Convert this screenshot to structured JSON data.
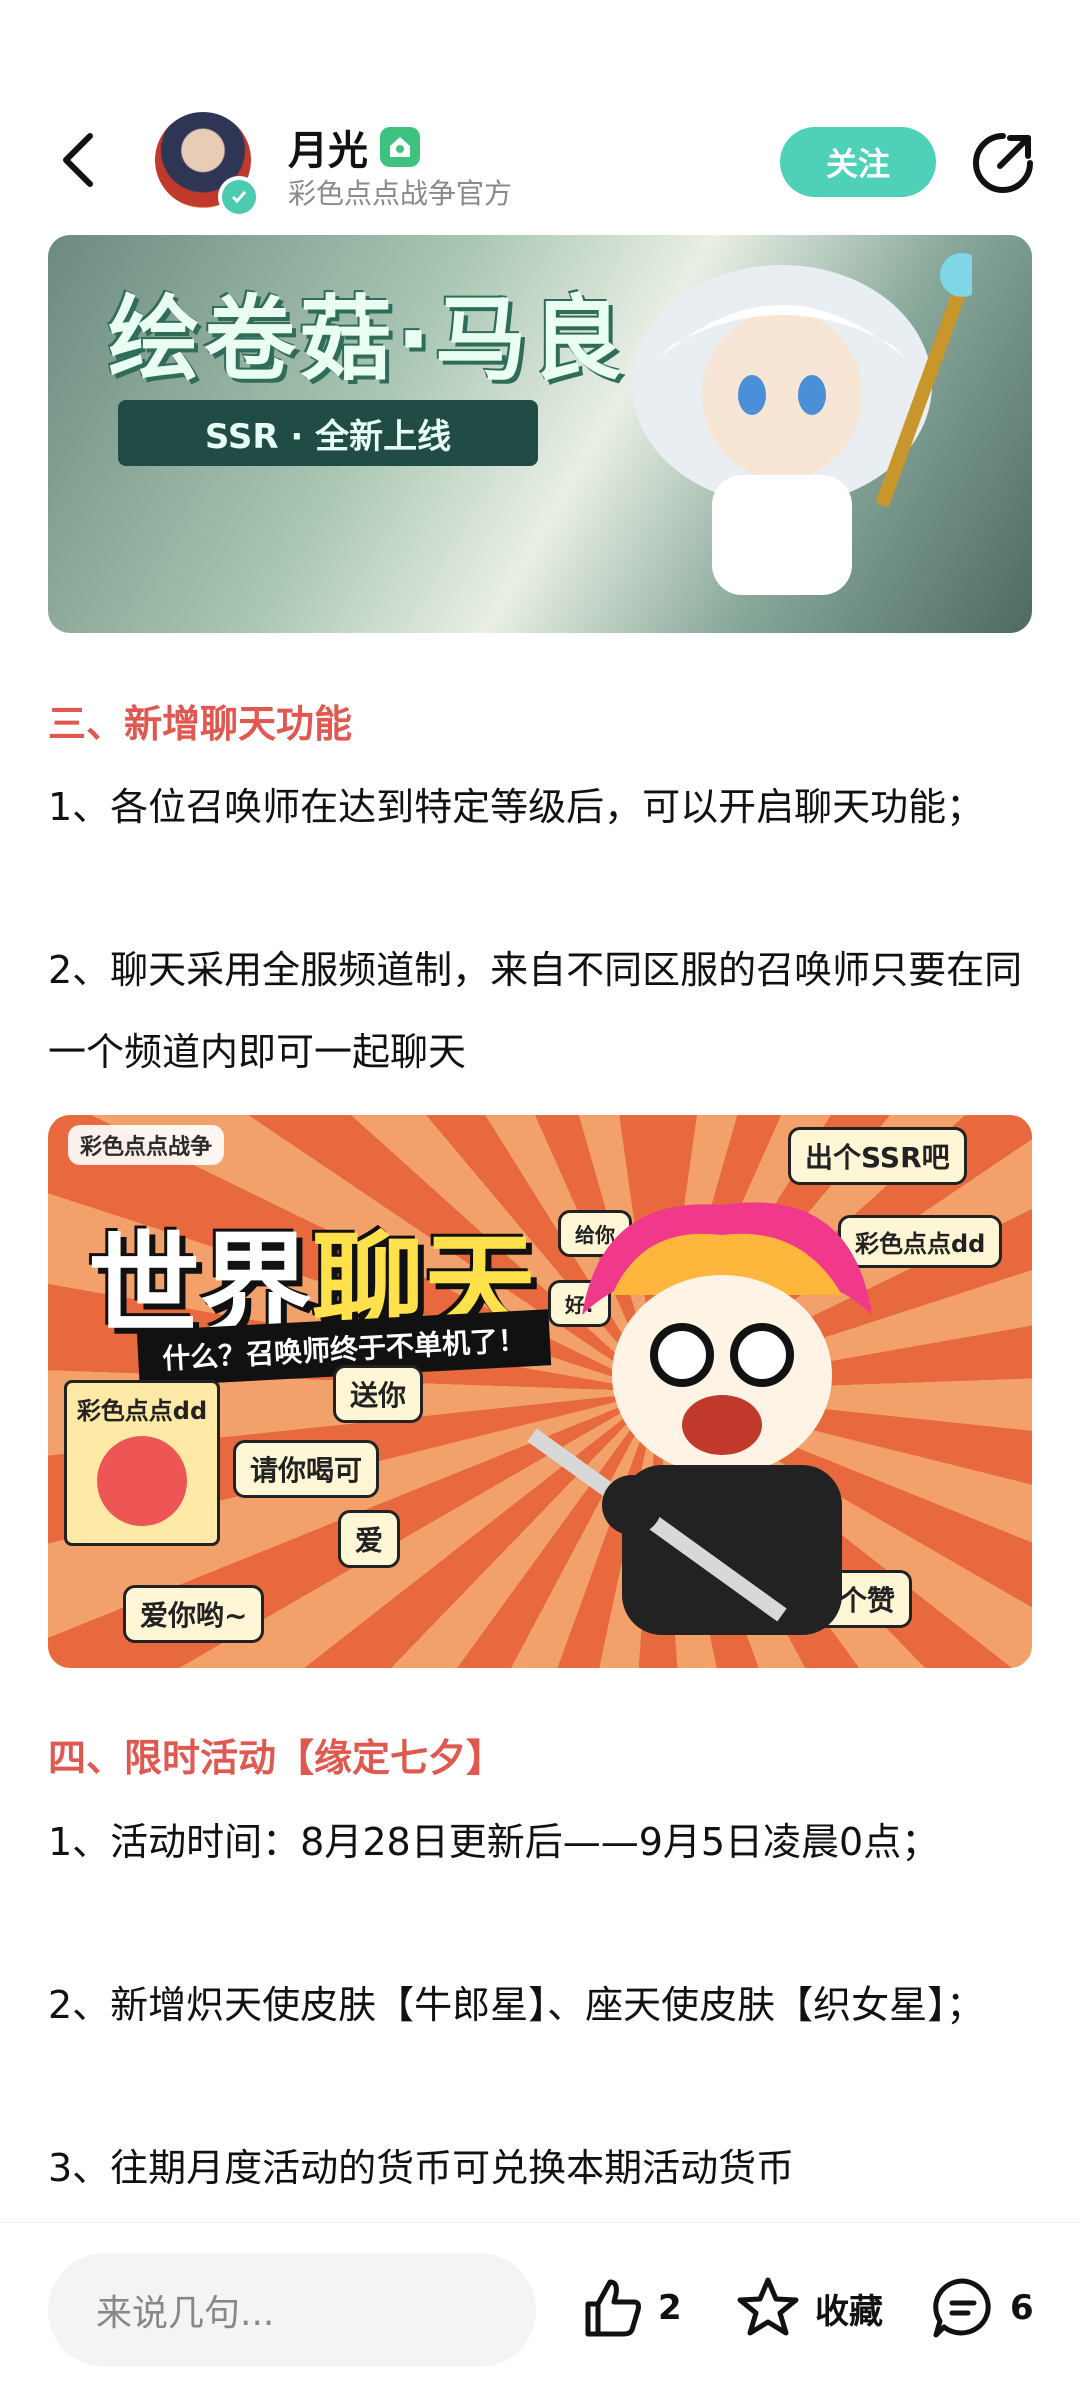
{
  "header": {
    "username": "月光",
    "subtitle": "彩色点点战争官方",
    "follow_label": "关注"
  },
  "banner1": {
    "title": "绘卷菇·马良",
    "subtitle": "SSR · 全新上线"
  },
  "sections": [
    {
      "title": "三、新增聊天功能",
      "paragraphs": [
        "1、各位召唤师在达到特定等级后，可以开启聊天功能；",
        "2、聊天采用全服频道制，来自不同区服的召唤师只要在同一个频道内即可一起聊天"
      ]
    },
    {
      "title": "四、限时活动【缘定七夕】",
      "paragraphs": [
        "1、活动时间：8月28日更新后——9月5日凌晨0点；",
        "2、新增炽天使皮肤【牛郎星】、座天使皮肤【织女星】；",
        "3、往期月度活动的货币可兑换本期活动货币"
      ]
    }
  ],
  "banner2": {
    "logo": "彩色点点战争",
    "title_white": "世界",
    "title_yellow": "聊天",
    "tagline": "什么？召唤师终于不单机了！",
    "card_label": "彩色点点dd",
    "bubbles": [
      "出个SSR吧",
      "彩色点点dd",
      "送你",
      "请你喝可",
      "爱",
      "爱你哟~",
      "给你点个赞",
      "给你",
      "好!"
    ]
  },
  "bottom": {
    "comment_placeholder": "来说几句...",
    "like_count": "2",
    "favorite_label": "收藏",
    "comment_count": "6"
  },
  "colors": {
    "accent": "#4fd0b8",
    "section_title": "#e0584f"
  }
}
